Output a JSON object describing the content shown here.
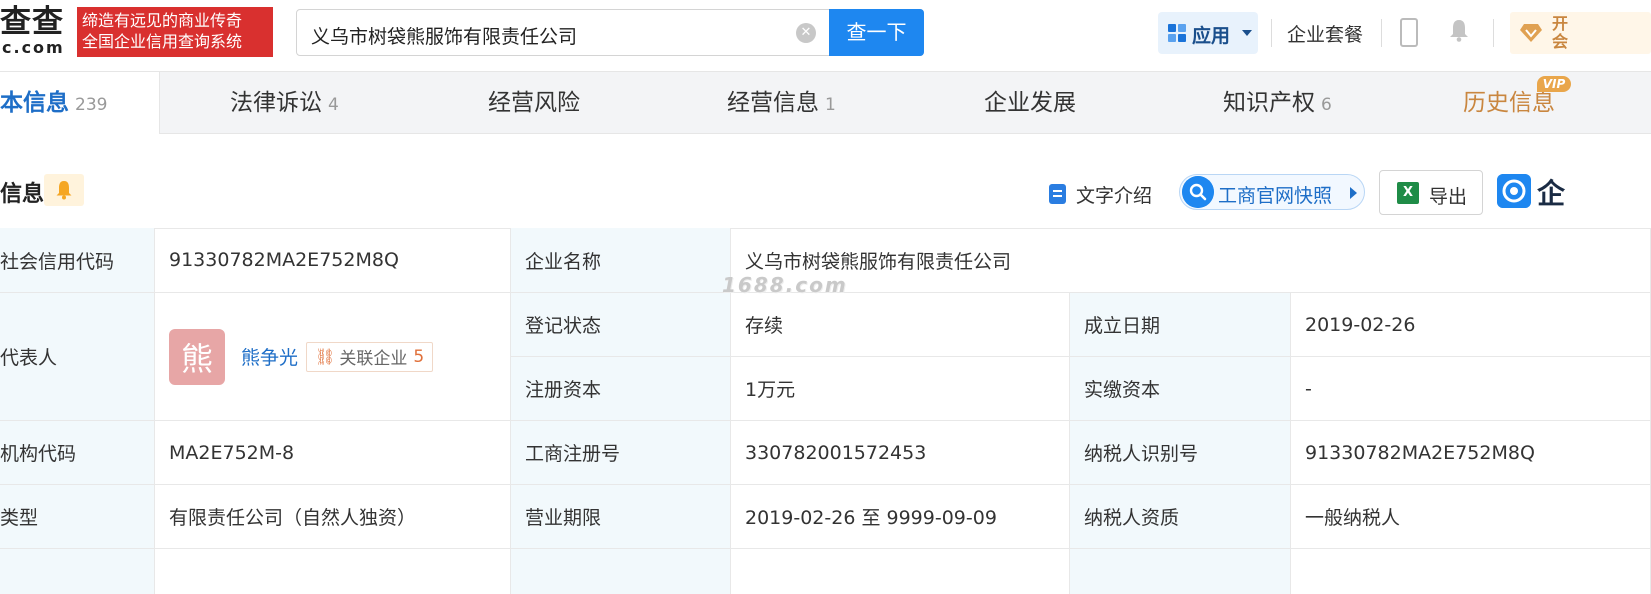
{
  "header": {
    "logo_main": "查查",
    "logo_sub": "c.com",
    "slogan_line1": "缔造有远见的商业传奇",
    "slogan_line2": "全国企业信用查询系统",
    "search_value": "义乌市树袋熊服饰有限责任公司",
    "search_button": "查一下",
    "apps_label": "应用",
    "enterprise_suite": "企业套餐",
    "vip_line1": "开",
    "vip_line2": "会"
  },
  "tabs": [
    {
      "label": "本信息",
      "count": "239"
    },
    {
      "label": "法律诉讼",
      "count": "4"
    },
    {
      "label": "经营风险",
      "count": ""
    },
    {
      "label": "经营信息",
      "count": "1"
    },
    {
      "label": "企业发展",
      "count": ""
    },
    {
      "label": "知识产权",
      "count": "6"
    },
    {
      "label": "历史信息",
      "count": ""
    }
  ],
  "vip_tag": "VIP",
  "section": {
    "title": "信息",
    "text_intro": "文字介绍",
    "snapshot": "工商官网快照",
    "export": "导出",
    "qi_text": "企"
  },
  "watermark": "1688.com",
  "info": {
    "credit_code_label": "社会信用代码",
    "credit_code": "91330782MA2E752M8Q",
    "company_name_label": "企业名称",
    "company_name": "义乌市树袋熊服饰有限责任公司",
    "legal_rep_label": "代表人",
    "avatar_char": "熊",
    "legal_rep_name": "熊争光",
    "related_label": "关联企业",
    "related_count": "5",
    "reg_status_label": "登记状态",
    "reg_status": "存续",
    "founded_label": "成立日期",
    "founded": "2019-02-26",
    "reg_capital_label": "注册资本",
    "reg_capital": "1万元",
    "paid_capital_label": "实缴资本",
    "paid_capital": "-",
    "org_code_label": "机构代码",
    "org_code": "MA2E752M-8",
    "biz_reg_no_label": "工商注册号",
    "biz_reg_no": "330782001572453",
    "taxpayer_id_label": "纳税人识别号",
    "taxpayer_id": "91330782MA2E752M8Q",
    "type_label": "类型",
    "type": "有限责任公司（自然人独资）",
    "biz_term_label": "营业期限",
    "biz_term": "2019-02-26 至 9999-09-09",
    "taxpayer_qual_label": "纳税人资质",
    "taxpayer_qual": "一般纳税人"
  }
}
